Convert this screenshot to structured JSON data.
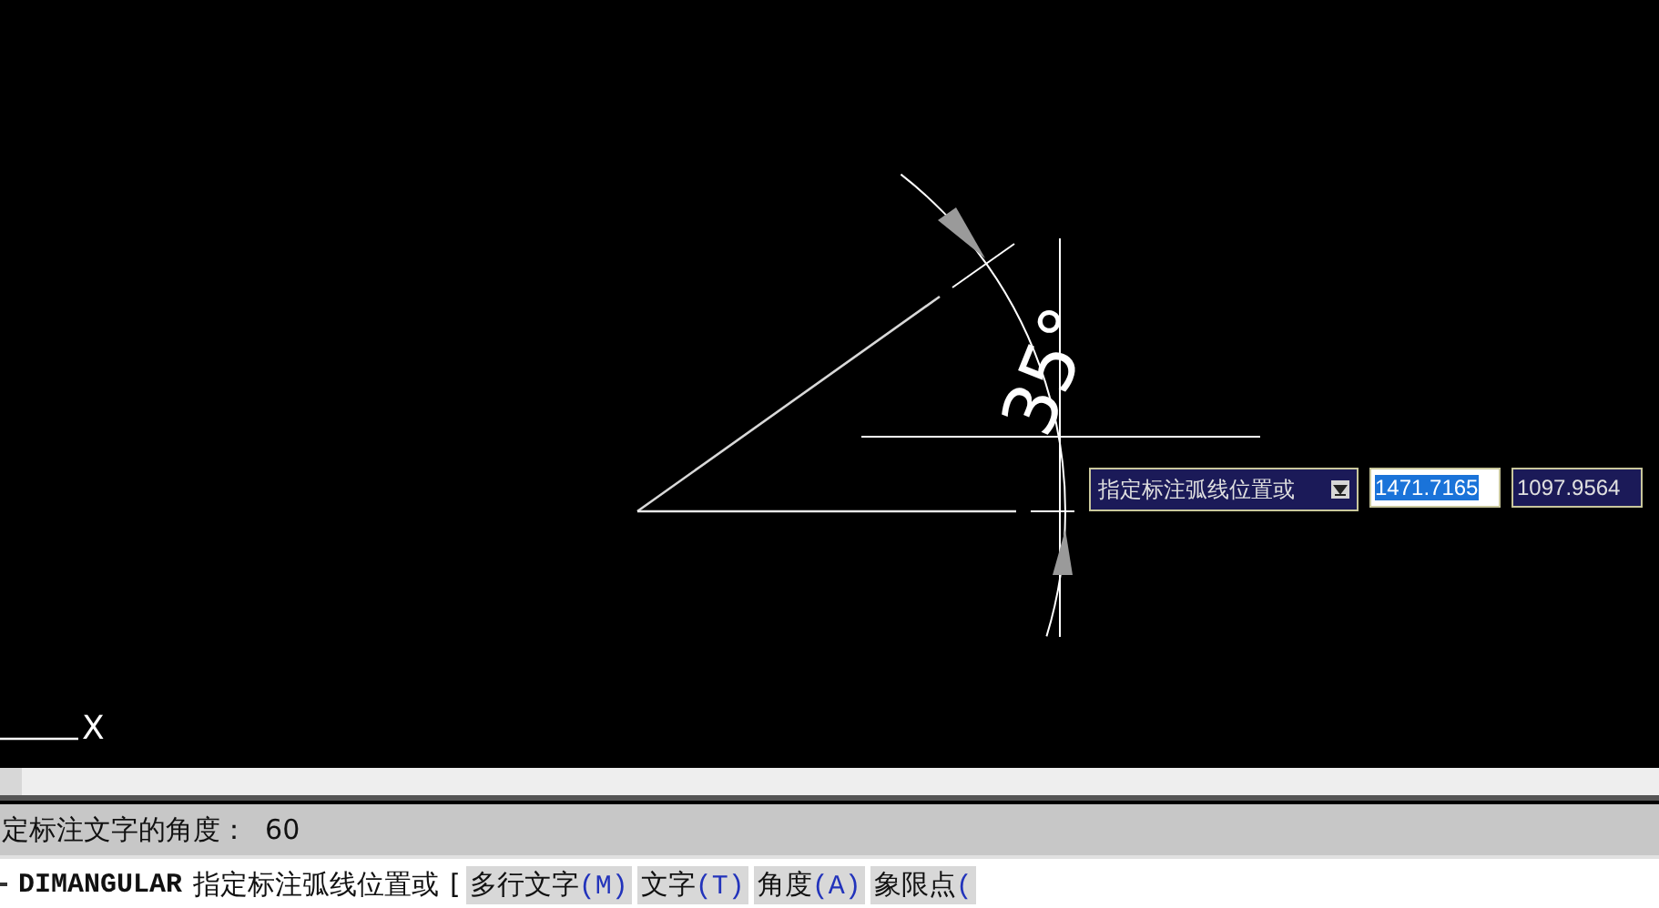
{
  "canvas": {
    "dimension_text": "35°",
    "ucs_x_label": "X"
  },
  "tooltip": {
    "prompt": "指定标注弧线位置或"
  },
  "coordinate_fields": [
    {
      "value": "1471.7165",
      "selected": true
    },
    {
      "value": "1097.9564",
      "selected": false
    }
  ],
  "command_history": {
    "text": "定标注文字的角度：  60"
  },
  "command_line": {
    "command": "DIMANGULAR",
    "prompt": "指定标注弧线位置或",
    "bracket": "[",
    "options": [
      {
        "label": "多行文字",
        "key": "(M)"
      },
      {
        "label": "文字",
        "key": "(T)"
      },
      {
        "label": "角度",
        "key": "(A)"
      },
      {
        "label": "象限点",
        "key": "("
      }
    ]
  }
}
